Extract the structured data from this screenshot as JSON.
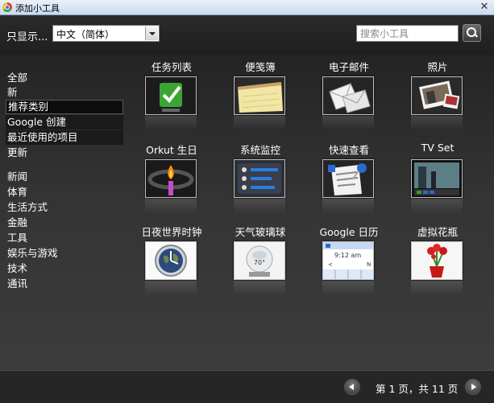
{
  "window": {
    "title": "添加小工具",
    "close_glyph": "✕"
  },
  "toolbar": {
    "show_label": "只显示...",
    "language_selected": "中文（简体）",
    "search_placeholder": "搜索小工具"
  },
  "sidebar": {
    "categories": [
      {
        "label": "全部",
        "selected": false
      },
      {
        "label": "新",
        "selected": false
      },
      {
        "label": "推荐类别",
        "selected": true
      },
      {
        "label": "Google 创建",
        "selected": false
      },
      {
        "label": "最近使用的项目",
        "selected": false
      },
      {
        "label": "更新",
        "selected": false
      },
      {
        "label": "新闻",
        "selected": false
      },
      {
        "label": "体育",
        "selected": false
      },
      {
        "label": "生活方式",
        "selected": false
      },
      {
        "label": "金融",
        "selected": false
      },
      {
        "label": "工具",
        "selected": false
      },
      {
        "label": "娱乐与游戏",
        "selected": false
      },
      {
        "label": "技术",
        "selected": false
      },
      {
        "label": "通讯",
        "selected": false
      }
    ]
  },
  "gadgets": [
    {
      "label": "任务列表",
      "icon": "task-list-checkmark-icon"
    },
    {
      "label": "便笺簿",
      "icon": "notepad-icon"
    },
    {
      "label": "电子邮件",
      "icon": "email-envelopes-icon"
    },
    {
      "label": "照片",
      "icon": "photos-icon"
    },
    {
      "label": "Orkut 生日",
      "icon": "orkut-birthday-candle-icon"
    },
    {
      "label": "系统监控",
      "icon": "system-monitor-icon"
    },
    {
      "label": "快速查看",
      "icon": "quick-view-pin-icon"
    },
    {
      "label": "TV Set",
      "icon": "tv-set-icon"
    },
    {
      "label": "日夜世界时钟",
      "icon": "world-clock-icon"
    },
    {
      "label": "天气玻璃球",
      "icon": "weather-globe-icon",
      "thumb_text": "70°"
    },
    {
      "label": "Google 日历",
      "icon": "google-calendar-icon",
      "thumb_time": "9:12 am",
      "thumb_nav_prev": "<",
      "thumb_nav_next": "N"
    },
    {
      "label": "虚拟花瓶",
      "icon": "virtual-vase-icon"
    }
  ],
  "footer": {
    "page_info": "第 1 页，共 11 页"
  },
  "colors": {
    "background": "#2b2b2b",
    "accent_green": "#3a9a2a",
    "calendar_blue": "#2a6ad1"
  }
}
